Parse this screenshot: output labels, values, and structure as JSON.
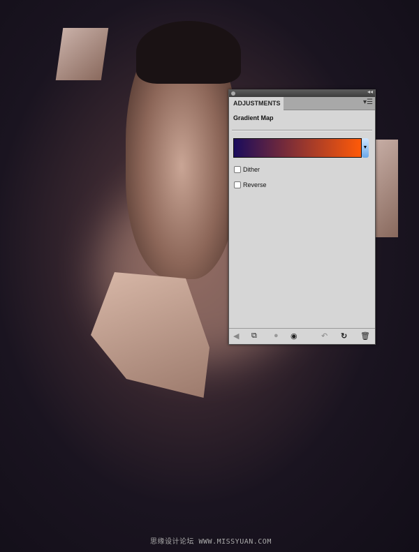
{
  "panel": {
    "tab_label": "ADJUSTMENTS",
    "heading": "Gradient Map",
    "gradient": {
      "start_color": "#1a0c5c",
      "end_color": "#ff5a08"
    },
    "dither_label": "Dither",
    "dither_checked": false,
    "reverse_label": "Reverse",
    "reverse_checked": false,
    "menu_icon": "panel-menu-icon",
    "collapse_icon": "collapse-icon",
    "footer_icons": [
      "back-arrow-icon",
      "expand-view-icon",
      "clip-layer-icon",
      "visibility-eye-icon",
      "previous-state-icon",
      "reset-icon",
      "trash-icon"
    ]
  },
  "watermark": "思缘设计论坛 WWW.MISSYUAN.COM"
}
